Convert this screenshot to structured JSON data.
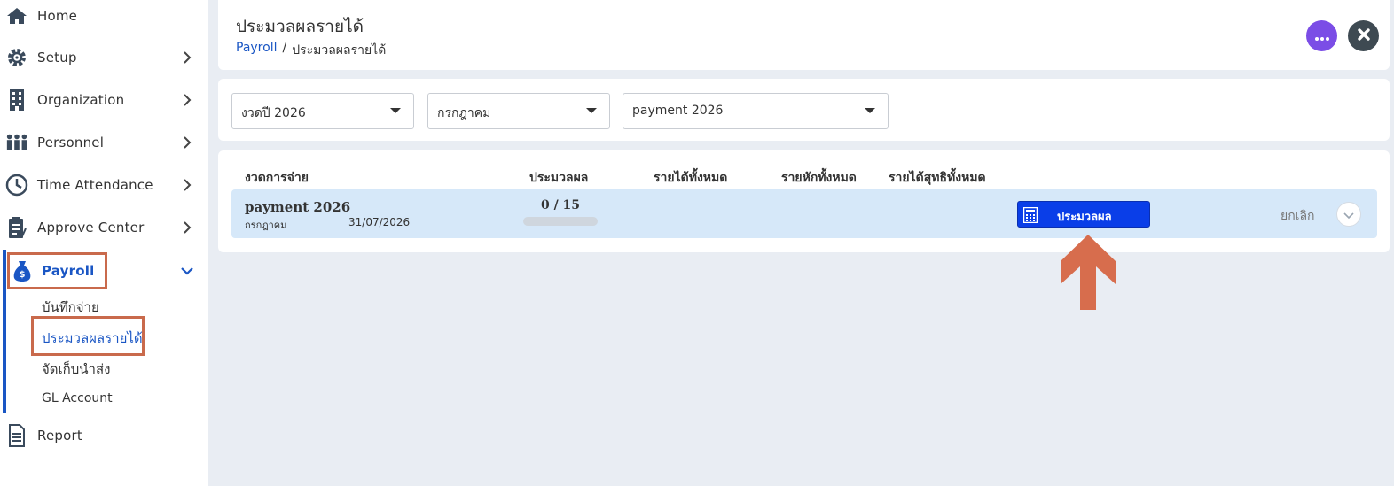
{
  "sidebar": {
    "items": [
      {
        "label": "Home",
        "icon": "home-icon"
      },
      {
        "label": "Setup",
        "icon": "gear-icon"
      },
      {
        "label": "Organization",
        "icon": "building-icon"
      },
      {
        "label": "Personnel",
        "icon": "people-icon"
      },
      {
        "label": "Time Attendance",
        "icon": "clock-icon"
      },
      {
        "label": "Approve Center",
        "icon": "clipboard-icon"
      },
      {
        "label": "Payroll",
        "icon": "money-bag-icon"
      },
      {
        "label": "Report",
        "icon": "document-icon"
      }
    ],
    "payroll_sub": [
      {
        "label": "บันทึกจ่าย"
      },
      {
        "label": "ประมวลผลรายได้"
      },
      {
        "label": "จัดเก็บนำส่ง"
      },
      {
        "label": "GL Account"
      }
    ]
  },
  "header": {
    "title": "ประมวลผลรายได้",
    "breadcrumb_root": "Payroll",
    "breadcrumb_sep": "/",
    "breadcrumb_current": "ประมวลผลรายได้"
  },
  "filters": {
    "year": "งวดปี 2026",
    "month": "กรกฎาคม",
    "payment": "payment 2026"
  },
  "table": {
    "headers": [
      "งวดการจ่าย",
      "ประมวลผล",
      "รายได้ทั้งหมด",
      "รายหักทั้งหมด",
      "รายได้สุทธิทั้งหมด"
    ],
    "rows": [
      {
        "name": "payment 2026",
        "month": "กรกฎาคม",
        "date": "31/07/2026",
        "progress_text": "0 / 15",
        "progress_fraction": 0,
        "process_label": "ประมวลผล",
        "cancel_label": "ยกเลิก"
      }
    ]
  },
  "colors": {
    "accent": "#1a56c4",
    "process_button": "#0a3ee8",
    "highlight": "#c96a4c",
    "more_button": "#7b4de6"
  }
}
